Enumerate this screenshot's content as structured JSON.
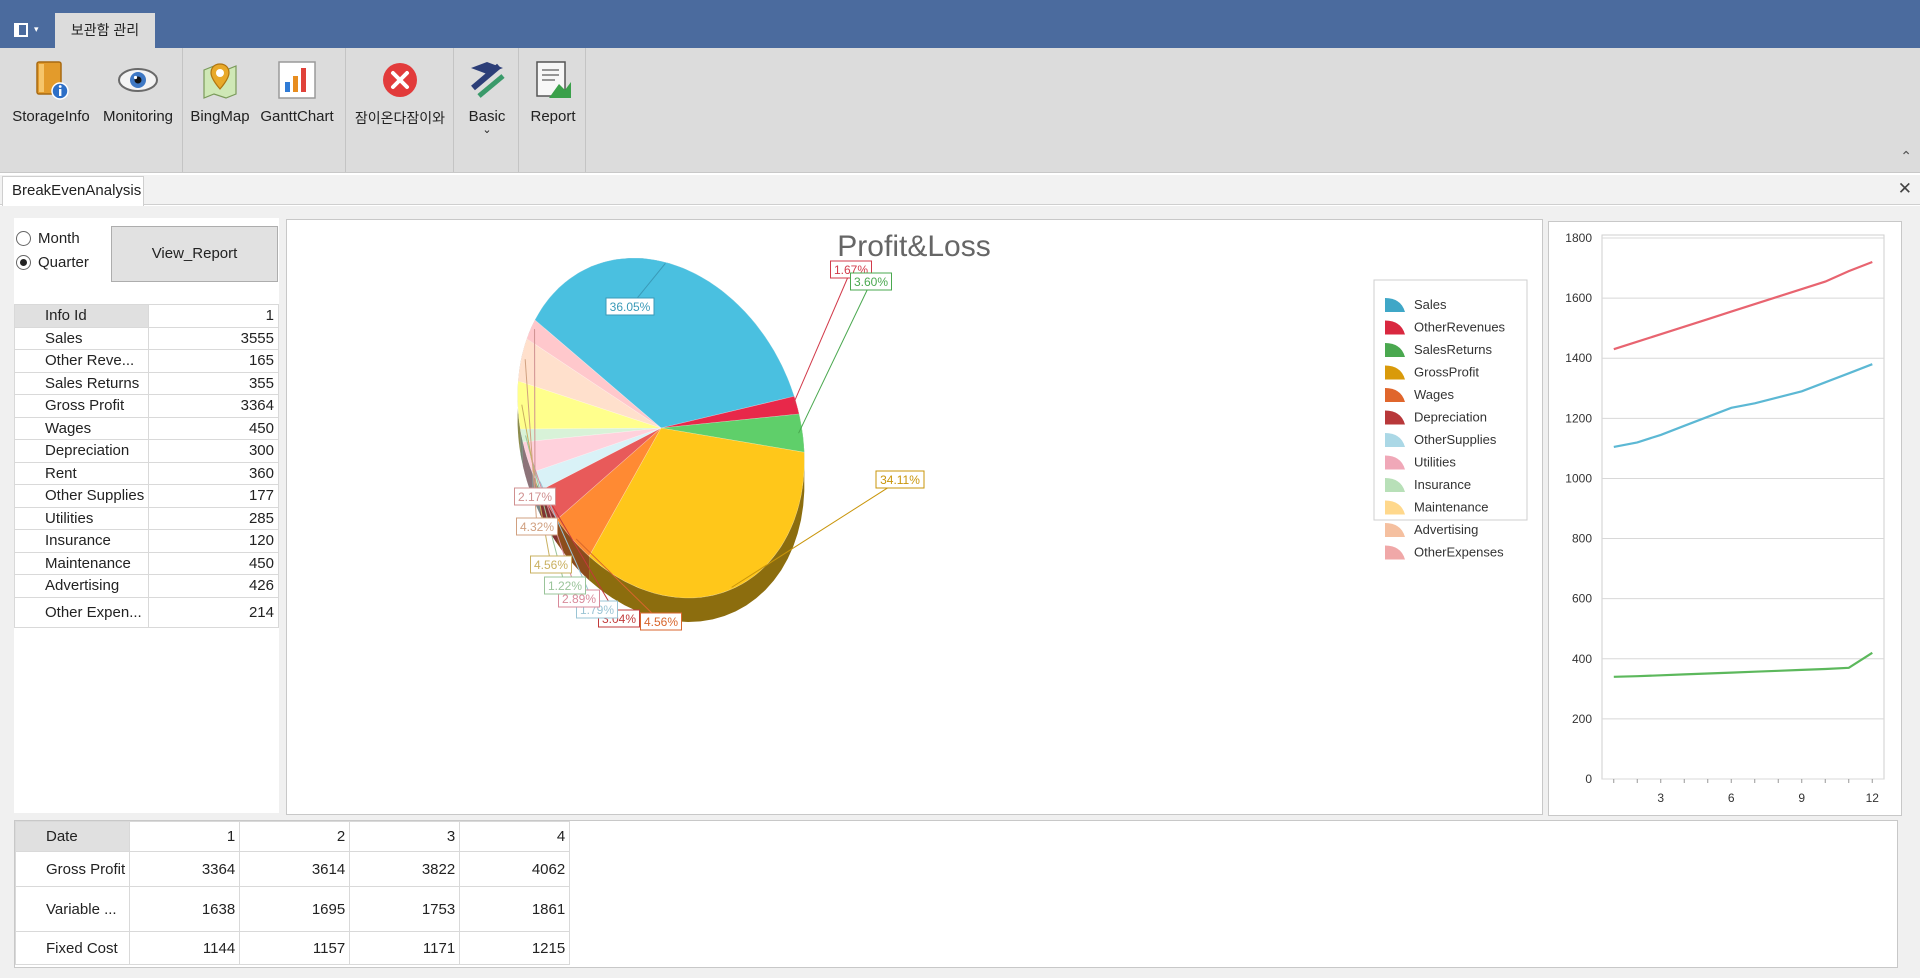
{
  "app_menu": {
    "icon": "menu-icon"
  },
  "ribbon": {
    "tab": "보관함 관리",
    "buttons": [
      {
        "label": "StorageInfo",
        "icon": "storage-info-icon"
      },
      {
        "label": "Monitoring",
        "icon": "eye-icon"
      },
      {
        "label": "BingMap",
        "icon": "map-icon"
      },
      {
        "label": "GanttChart",
        "icon": "gantt-chart-icon"
      },
      {
        "label": "잠이온다잠이와",
        "icon": "close-circle-icon"
      },
      {
        "label": "Basic",
        "icon": "basic-icon"
      },
      {
        "label": "Report",
        "icon": "report-icon"
      }
    ]
  },
  "document_tab": {
    "label": "BreakEvenAnalysis"
  },
  "left_panel": {
    "radios": [
      {
        "label": "Month",
        "selected": false
      },
      {
        "label": "Quarter",
        "selected": true
      }
    ],
    "view_button": "View_Report",
    "rows": [
      {
        "key": "Info Id",
        "value": "1"
      },
      {
        "key": "Sales",
        "value": "3555"
      },
      {
        "key": "Other Reve...",
        "value": "165"
      },
      {
        "key": "Sales Returns",
        "value": "355"
      },
      {
        "key": "Gross Profit",
        "value": "3364"
      },
      {
        "key": "Wages",
        "value": "450"
      },
      {
        "key": "Depreciation",
        "value": "300"
      },
      {
        "key": "Rent",
        "value": "360"
      },
      {
        "key": "Other Supplies",
        "value": "177"
      },
      {
        "key": "Utilities",
        "value": "285"
      },
      {
        "key": "Insurance",
        "value": "120"
      },
      {
        "key": "Maintenance",
        "value": "450"
      },
      {
        "key": "Advertising",
        "value": "426"
      },
      {
        "key": "Other Expen...",
        "value": "214"
      }
    ]
  },
  "chart_data": [
    {
      "type": "pie",
      "title": "Profit&Loss",
      "legend_position": "top-right",
      "series": [
        {
          "name": "Sales",
          "pct": 36.05,
          "label": "36.05%",
          "color": "#4ac0e0"
        },
        {
          "name": "OtherRevenues",
          "pct": 1.67,
          "label": "1.67%",
          "color": "#e8284a"
        },
        {
          "name": "SalesReturns",
          "pct": 3.6,
          "label": "3.60%",
          "color": "#5fcf6a"
        },
        {
          "name": "GrossProfit",
          "pct": 34.11,
          "label": "34.11%",
          "color": "#ffc71a"
        },
        {
          "name": "Wages",
          "pct": 4.56,
          "label": "4.56%",
          "color": "#ff8a33"
        },
        {
          "name": "Depreciation",
          "pct": 3.04,
          "label": "3.04%",
          "color": "#e85a5a"
        },
        {
          "name": "OtherSupplies",
          "pct": 1.79,
          "label": "1.79%",
          "color": "#d9f2f7"
        },
        {
          "name": "Utilities",
          "pct": 2.89,
          "label": "2.89%",
          "color": "#ffd1dc"
        },
        {
          "name": "Insurance",
          "pct": 1.22,
          "label": "1.22%",
          "color": "#d8f2d8"
        },
        {
          "name": "Maintenance",
          "pct": 4.56,
          "label": "4.56%",
          "color": "#ffff8c"
        },
        {
          "name": "Advertising",
          "pct": 4.32,
          "label": "4.32%",
          "color": "#ffe0cc"
        },
        {
          "name": "OtherExpenses",
          "pct": 2.17,
          "label": "2.17%",
          "color": "#ffc8cc"
        }
      ],
      "legend_colors": [
        "#3fa7c7",
        "#d9283f",
        "#4aa84f",
        "#d99a0a",
        "#e0662c",
        "#b8383a",
        "#abd8e6",
        "#f0a8b8",
        "#b8e0b8",
        "#ffd88c",
        "#f5c0a0",
        "#f0a8a8"
      ],
      "label_colors": [
        "#3a9ab8",
        "#d23a4a",
        "#4aa84f",
        "#c9950a",
        "#d8662c",
        "#c23a3a",
        "#9ac4d4",
        "#d88a9a",
        "#9ac49a",
        "#c9b060",
        "#d0a080",
        "#d09090"
      ]
    },
    {
      "type": "line",
      "x": [
        1,
        2,
        3,
        4,
        5,
        6,
        7,
        8,
        9,
        10,
        11,
        12
      ],
      "xticks": [
        3,
        6,
        9,
        12
      ],
      "ylim": [
        0,
        1800
      ],
      "yticks": [
        0,
        200,
        400,
        600,
        800,
        1000,
        1200,
        1400,
        1600,
        1800
      ],
      "grid": true,
      "series": [
        {
          "color": "#e86470",
          "values": [
            1430,
            1455,
            1480,
            1505,
            1530,
            1555,
            1580,
            1605,
            1630,
            1655,
            1690,
            1720
          ]
        },
        {
          "color": "#5cb8d4",
          "values": [
            1105,
            1120,
            1145,
            1175,
            1205,
            1235,
            1250,
            1270,
            1290,
            1320,
            1350,
            1380
          ]
        },
        {
          "color": "#5cb85c",
          "values": [
            340,
            342,
            345,
            348,
            351,
            354,
            357,
            360,
            363,
            366,
            370,
            420
          ]
        }
      ]
    }
  ],
  "bottom_table": {
    "headers": [
      "Date",
      "1",
      "2",
      "3",
      "4"
    ],
    "rows": [
      [
        "Gross Profit",
        "3364",
        "3614",
        "3822",
        "4062"
      ],
      [
        "Variable ...",
        "1638",
        "1695",
        "1753",
        "1861"
      ],
      [
        "Fixed Cost",
        "1144",
        "1157",
        "1171",
        "1215"
      ]
    ]
  }
}
